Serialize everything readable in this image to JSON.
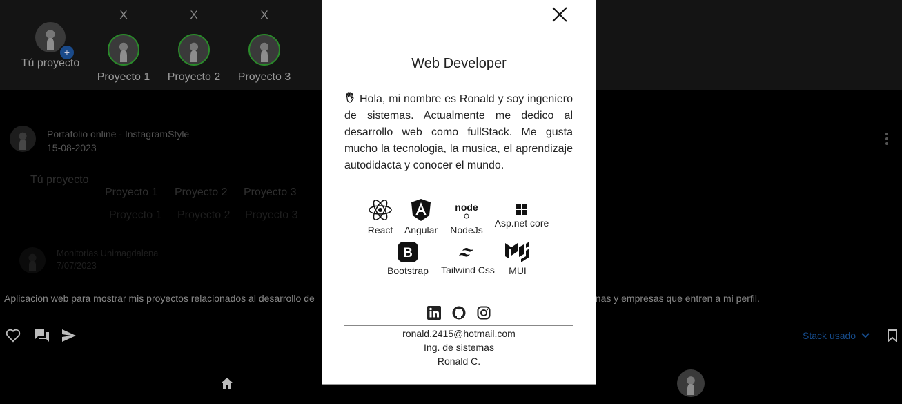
{
  "stories": {
    "own": {
      "label": "Tú proyecto"
    },
    "projects": [
      {
        "label": "Proyecto 1",
        "close": "X"
      },
      {
        "label": "Proyecto 2",
        "close": "X"
      },
      {
        "label": "Proyecto 3",
        "close": "X"
      }
    ]
  },
  "post": {
    "title": "Portafolio online - InstagramStyle",
    "date": "15-08-2023",
    "ghost_own": "Tú proyecto",
    "ghost_projects": [
      "Proyecto 1",
      "Proyecto 2",
      "Proyecto 3"
    ],
    "ghost_projects_faded": [
      "Proyecto 1",
      "Proyecto 2",
      "Proyecto 3"
    ],
    "second_title": "Monitorias Unimagdalena",
    "second_date": "7/07/2023",
    "description_left": "Aplicacion web para mostrar mis proyectos relacionados al desarrollo de",
    "description_right": "sonas y empresas que entren a mi perfil.",
    "stack_used": "Stack usado"
  },
  "modal": {
    "title": "Web Developer",
    "bio": "Hola, mi nombre es Ronald y soy ingeniero de sistemas. Actualmente me dedico al desarrollo web como fullStack. Me gusta mucho la tecnologia, la musica, el aprendizaje autodidacta y conocer el mundo.",
    "tech_row1": [
      {
        "label": "React",
        "icon": "react-icon"
      },
      {
        "label": "Angular",
        "icon": "angular-icon"
      },
      {
        "label": "NodeJs",
        "icon": "nodejs-icon"
      },
      {
        "label": "Asp.net core",
        "icon": "windows-icon"
      }
    ],
    "tech_row2": [
      {
        "label": "Bootstrap",
        "icon": "bootstrap-icon"
      },
      {
        "label": "Tailwind Css",
        "icon": "tailwind-icon"
      },
      {
        "label": "MUI",
        "icon": "mui-icon"
      }
    ],
    "email": "ronald.2415@hotmail.com",
    "role": "Ing. de sistemas",
    "name": "Ronald C."
  }
}
